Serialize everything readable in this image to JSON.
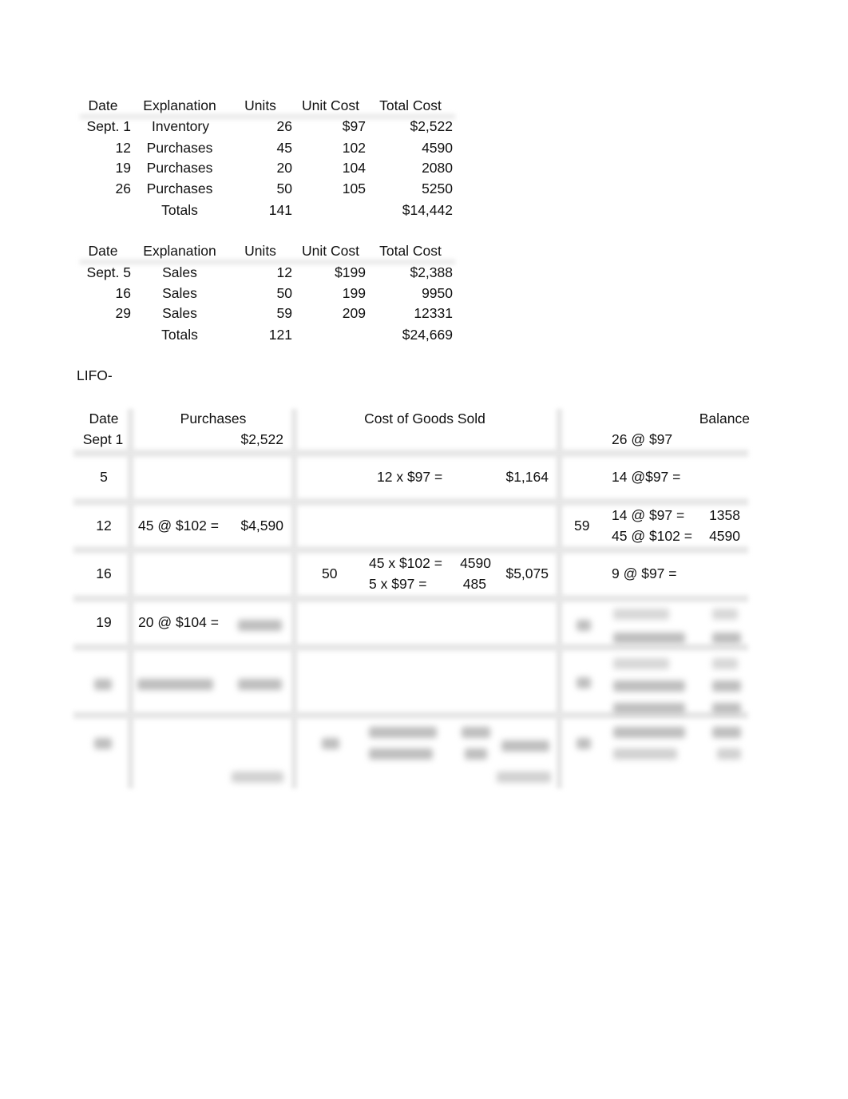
{
  "purchases_table": {
    "headers": [
      "Date",
      "Explanation",
      "Units",
      "Unit Cost",
      "Total Cost"
    ],
    "rows": [
      {
        "date": "Sept. 1",
        "explanation": "Inventory",
        "units": "26",
        "unit_cost": "$97",
        "total_cost": "$2,522"
      },
      {
        "date": "12",
        "explanation": "Purchases",
        "units": "45",
        "unit_cost": "102",
        "total_cost": "4590"
      },
      {
        "date": "19",
        "explanation": "Purchases",
        "units": "20",
        "unit_cost": "104",
        "total_cost": "2080"
      },
      {
        "date": "26",
        "explanation": "Purchases",
        "units": "50",
        "unit_cost": "105",
        "total_cost": "5250"
      }
    ],
    "totals": {
      "label": "Totals",
      "units": "141",
      "total_cost": "$14,442"
    }
  },
  "sales_table": {
    "headers": [
      "Date",
      "Explanation",
      "Units",
      "Unit Cost",
      "Total Cost"
    ],
    "rows": [
      {
        "date": "Sept. 5",
        "explanation": "Sales",
        "units": "12",
        "unit_cost": "$199",
        "total_cost": "$2,388"
      },
      {
        "date": "16",
        "explanation": "Sales",
        "units": "50",
        "unit_cost": "199",
        "total_cost": "9950"
      },
      {
        "date": "29",
        "explanation": "Sales",
        "units": "59",
        "unit_cost": "209",
        "total_cost": "12331"
      }
    ],
    "totals": {
      "label": "Totals",
      "units": "121",
      "total_cost": "$24,669"
    }
  },
  "lifo": {
    "title": "LIFO-",
    "headers": {
      "date": "Date",
      "purchases": "Purchases",
      "cogs": "Cost of Goods Sold",
      "balance": "Balance"
    },
    "rows": [
      {
        "date": "Sept 1",
        "purchase_amount": "$2,522",
        "balance_line1": "26 @ $97"
      },
      {
        "date": "5",
        "cogs_line1": "12 x $97 =",
        "cogs_total": "$1,164",
        "balance_line1": "14 @$97 ="
      },
      {
        "date": "12",
        "purchase_calc": "45 @ $102 =",
        "purchase_amount": "$4,590",
        "balance_units": "59",
        "balance_line1": "14 @ $97 =",
        "balance_value1": "1358",
        "balance_line2": "45 @ $102 =",
        "balance_value2": "4590"
      },
      {
        "date": "16",
        "cogs_units": "50",
        "cogs_line1": "45 x $102 =",
        "cogs_value1": "4590",
        "cogs_line2": "5 x $97 =",
        "cogs_value2": "485",
        "cogs_total": "$5,075",
        "balance_line1": "9 @ $97 ="
      },
      {
        "date": "19",
        "purchase_calc": "20 @ $104 ="
      }
    ]
  }
}
